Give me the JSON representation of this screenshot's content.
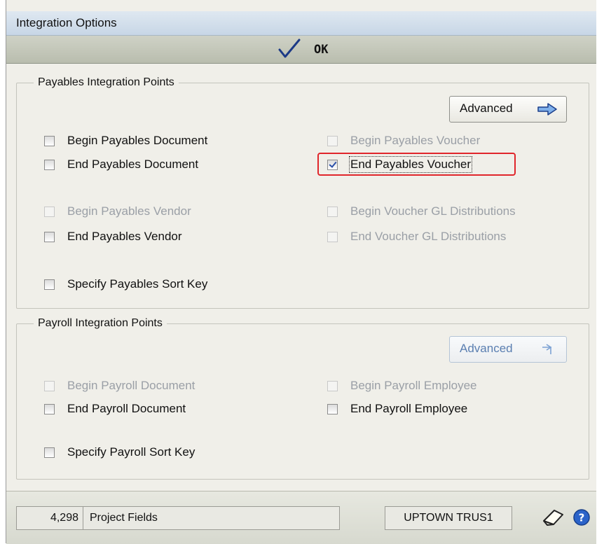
{
  "window": {
    "title": "Integration Options"
  },
  "toolbar": {
    "ok_label": "OK",
    "ok_icon": "checkmark-icon"
  },
  "payables_group": {
    "legend": "Payables Integration Points",
    "advanced_label": "Advanced",
    "advanced_icon": "arrow-right-icon",
    "options": [
      {
        "label": "Begin Payables Document",
        "checked": false,
        "enabled": true
      },
      {
        "label": "End Payables Document",
        "checked": false,
        "enabled": true
      },
      {
        "label": "Begin Payables Voucher",
        "checked": false,
        "enabled": false
      },
      {
        "label": "End Payables Voucher",
        "checked": true,
        "enabled": true
      },
      {
        "label": "Begin Payables Vendor",
        "checked": false,
        "enabled": false
      },
      {
        "label": "End Payables Vendor",
        "checked": false,
        "enabled": true
      },
      {
        "label": "Begin Voucher GL Distributions",
        "checked": false,
        "enabled": false
      },
      {
        "label": "End Voucher GL Distributions",
        "checked": false,
        "enabled": false
      },
      {
        "label": "Specify Payables Sort Key",
        "checked": false,
        "enabled": true
      }
    ]
  },
  "payroll_group": {
    "legend": "Payroll Integration Points",
    "advanced_label": "Advanced",
    "advanced_icon": "corner-arrow-icon",
    "options": [
      {
        "label": "Begin Payroll Document",
        "checked": false,
        "enabled": false
      },
      {
        "label": "End Payroll Document",
        "checked": false,
        "enabled": true
      },
      {
        "label": "Begin Payroll Employee",
        "checked": false,
        "enabled": false
      },
      {
        "label": "End Payroll Employee",
        "checked": false,
        "enabled": true
      },
      {
        "label": "Specify Payroll Sort Key",
        "checked": false,
        "enabled": true
      }
    ]
  },
  "status": {
    "count": "4,298",
    "label": "Project Fields",
    "company": "UPTOWN TRUS1",
    "note_icon": "note-icon",
    "help_icon": "help-icon"
  },
  "colors": {
    "highlight": "#e0262b",
    "disabled_text": "#9a9fa6",
    "check": "#2a4fa8"
  }
}
